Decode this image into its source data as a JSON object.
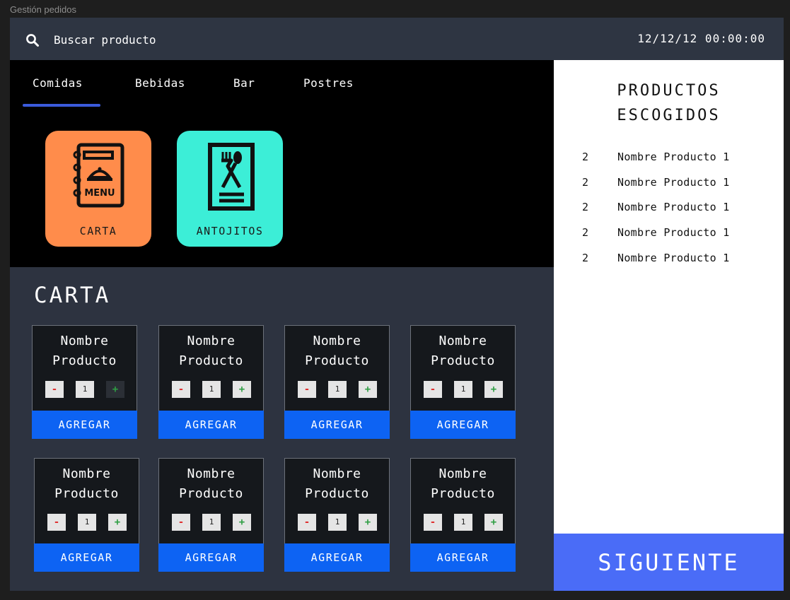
{
  "frame": {
    "label": "Gestión pedidos"
  },
  "header": {
    "search_placeholder": "Buscar producto",
    "datetime": "12/12/12 00:00:00"
  },
  "tabs": [
    {
      "label": "Comidas",
      "active": true
    },
    {
      "label": "Bebidas"
    },
    {
      "label": "Bar"
    },
    {
      "label": "Postres"
    }
  ],
  "categories": [
    {
      "label": "CARTA",
      "icon": "menu-book-icon",
      "color": "#ff8c4b"
    },
    {
      "label": "ANTOJITOS",
      "icon": "utensils-icon",
      "color": "#3ceed7"
    }
  ],
  "section": {
    "title": "CARTA"
  },
  "products": [
    {
      "name": "Nombre\nProducto",
      "qty": "1",
      "minus": "-",
      "plus": "+",
      "add_label": "AGREGAR"
    },
    {
      "name": "Nombre\nProducto",
      "qty": "1",
      "minus": "-",
      "plus": "+",
      "add_label": "AGREGAR"
    },
    {
      "name": "Nombre\nProducto",
      "qty": "1",
      "minus": "-",
      "plus": "+",
      "add_label": "AGREGAR"
    },
    {
      "name": "Nombre\nProducto",
      "qty": "1",
      "minus": "-",
      "plus": "+",
      "add_label": "AGREGAR"
    },
    {
      "name": "Nombre\nProducto",
      "qty": "1",
      "minus": "-",
      "plus": "+",
      "add_label": "AGREGAR"
    },
    {
      "name": "Nombre\nProducto",
      "qty": "1",
      "minus": "-",
      "plus": "+",
      "add_label": "AGREGAR"
    },
    {
      "name": "Nombre\nProducto",
      "qty": "1",
      "minus": "-",
      "plus": "+",
      "add_label": "AGREGAR"
    },
    {
      "name": "Nombre\nProducto",
      "qty": "1",
      "minus": "-",
      "plus": "+",
      "add_label": "AGREGAR"
    }
  ],
  "chosen": {
    "title": "PRODUCTOS\nESCOGIDOS",
    "items": [
      {
        "qty": "2",
        "name": "Nombre Producto 1"
      },
      {
        "qty": "2",
        "name": "Nombre Producto 1"
      },
      {
        "qty": "2",
        "name": "Nombre Producto 1"
      },
      {
        "qty": "2",
        "name": "Nombre Producto 1"
      },
      {
        "qty": "2",
        "name": "Nombre Producto 1"
      }
    ]
  },
  "next_button": {
    "label": "SIGUIENTE"
  },
  "colors": {
    "accent_blue": "#0d63f3",
    "next_blue": "#4a6cf7",
    "tab_underline": "#3b5bdb",
    "carta_orange": "#ff8c4b",
    "antojitos_teal": "#3ceed7"
  }
}
